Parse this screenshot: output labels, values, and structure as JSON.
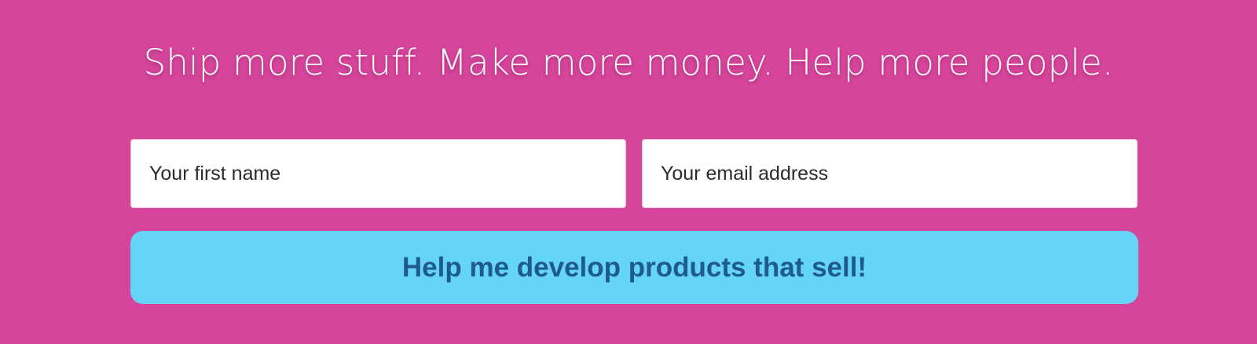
{
  "signup": {
    "headline": "Ship more stuff. Make more money. Help more people.",
    "first_name": {
      "placeholder": "Your first name",
      "value": ""
    },
    "email": {
      "placeholder": "Your email address",
      "value": ""
    },
    "submit_label": "Help me develop products that sell!"
  },
  "colors": {
    "background": "#d6459b",
    "headline_text": "#ffffff",
    "input_background": "#ffffff",
    "button_background": "#64d4f8",
    "button_text": "#1f5a8e"
  }
}
